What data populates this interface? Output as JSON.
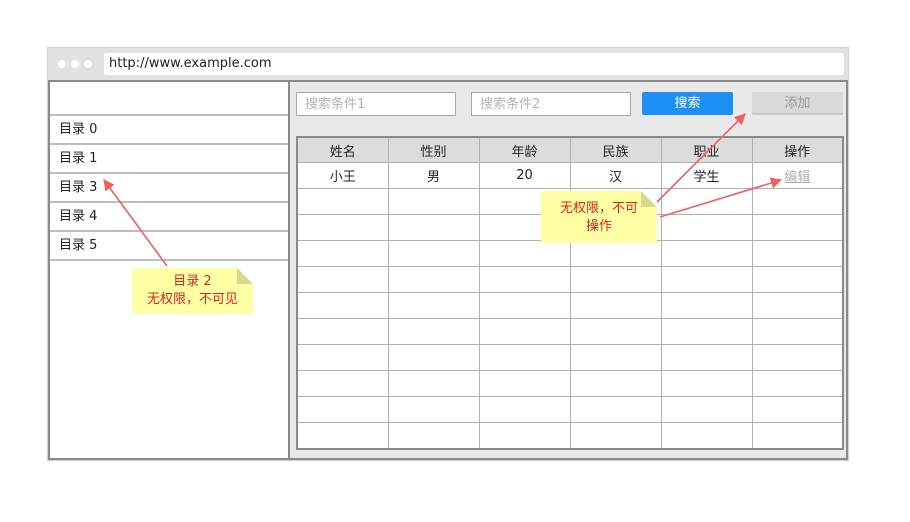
{
  "browser": {
    "url": "http://www.example.com"
  },
  "sidebar": {
    "items": [
      {
        "label": "目录 0"
      },
      {
        "label": "目录 1"
      },
      {
        "label": "目录 3"
      },
      {
        "label": "目录 4"
      },
      {
        "label": "目录 5"
      }
    ]
  },
  "toolbar": {
    "search1_placeholder": "搜索条件1",
    "search2_placeholder": "搜索条件2",
    "search_label": "搜索",
    "add_label": "添加"
  },
  "table": {
    "headers": [
      "姓名",
      "性别",
      "年龄",
      "民族",
      "职业",
      "操作"
    ],
    "rows": [
      [
        "小王",
        "男",
        "20",
        "汉",
        "学生",
        "编辑"
      ]
    ],
    "empty_rows": 10
  },
  "notes": {
    "sidebar_note": {
      "line1": "目录 2",
      "line2": "无权限，不可见"
    },
    "action_note": {
      "line1": "无权限，不可",
      "line2": "操作"
    }
  },
  "colors": {
    "primary_button": "#1e90f5",
    "note_background": "#ffffa6",
    "note_text": "#e0241b",
    "arrow": "#f06060"
  }
}
